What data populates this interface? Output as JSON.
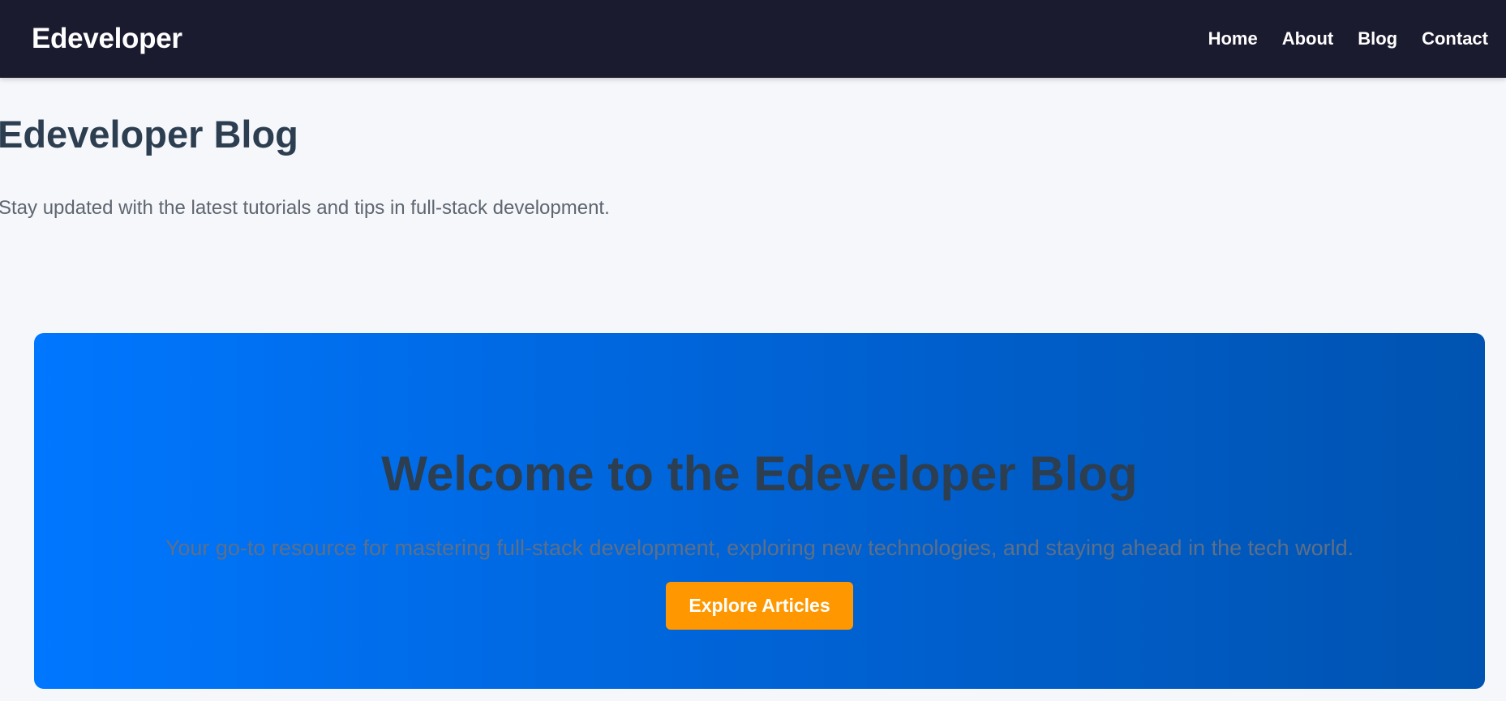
{
  "navbar": {
    "brand": "Edeveloper",
    "links": [
      {
        "label": "Home"
      },
      {
        "label": "About"
      },
      {
        "label": "Blog"
      },
      {
        "label": "Contact"
      }
    ]
  },
  "header": {
    "title": "Edeveloper Blog",
    "subtitle": "Stay updated with the latest tutorials and tips in full-stack development."
  },
  "hero": {
    "title": "Welcome to the Edeveloper Blog",
    "text": "Your go-to resource for mastering full-stack development, exploring new technologies, and staying ahead in the tech world.",
    "button_label": "Explore Articles"
  },
  "colors": {
    "navbar_bg": "#1b1b2f",
    "page_bg": "#f5f7fb",
    "hero_gradient_start": "#0077ff",
    "hero_gradient_end": "#0053b0",
    "button_bg": "#ff9800",
    "heading_text": "#2c3e50"
  }
}
